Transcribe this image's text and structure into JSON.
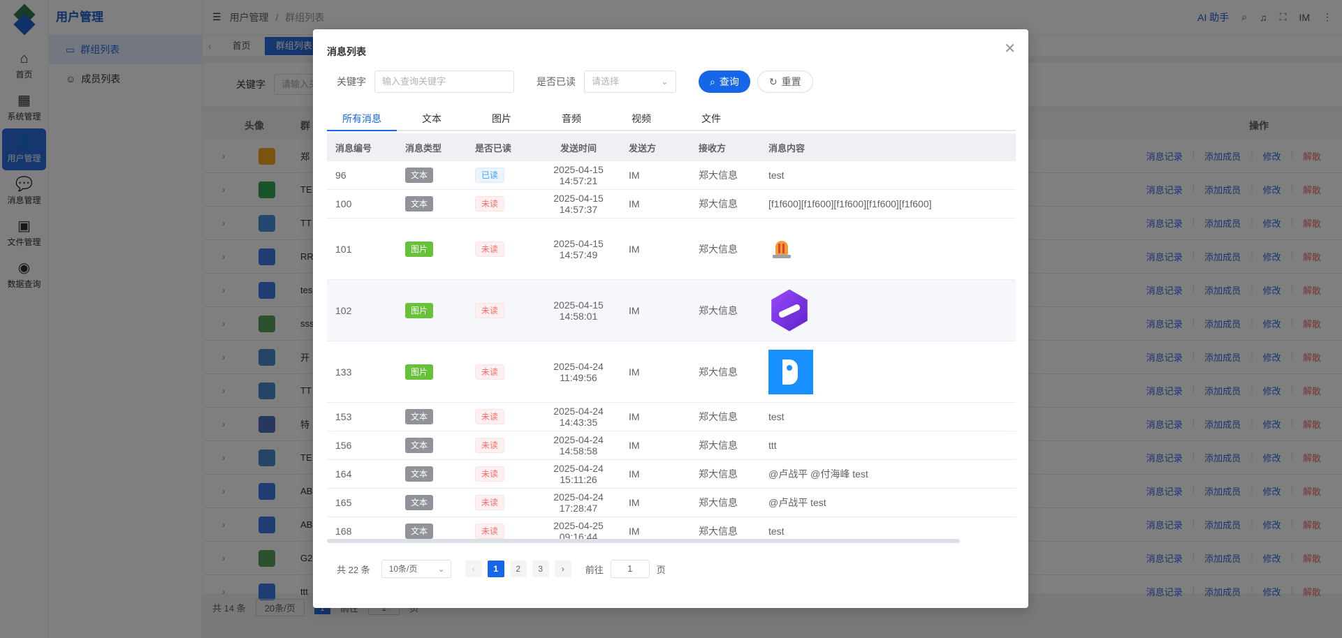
{
  "rail": [
    {
      "label": "首页",
      "icon": "home-icon",
      "glyph": "⌂"
    },
    {
      "label": "系统管理",
      "icon": "grid-icon",
      "glyph": "▦"
    },
    {
      "label": "用户管理",
      "icon": "user-icon",
      "glyph": "👤"
    },
    {
      "label": "消息管理",
      "icon": "chat-icon",
      "glyph": "💬"
    },
    {
      "label": "文件管理",
      "icon": "briefcase-icon",
      "glyph": "▣"
    },
    {
      "label": "数据查询",
      "icon": "compass-icon",
      "glyph": "◉"
    }
  ],
  "sidebar": {
    "title": "用户管理",
    "items": [
      {
        "label": "群组列表",
        "icon": "list-icon",
        "glyph": "▭"
      },
      {
        "label": "成员列表",
        "icon": "person-icon",
        "glyph": "☺"
      }
    ]
  },
  "topbar": {
    "menu_glyph": "☰",
    "crumb_1": "用户管理",
    "crumb_sep": "/",
    "crumb_2": "群组列表",
    "ai": "AI 助手",
    "user": "IM"
  },
  "tags": [
    "首页",
    "群组列表"
  ],
  "bg_search": {
    "label": "关键字",
    "placeholder": "请输入关"
  },
  "bg_table": {
    "col_avatar": "头像",
    "col_name": "群",
    "col_ops": "操作",
    "rows": [
      "郑",
      "TE",
      "TT",
      "RR",
      "tes",
      "sss",
      "开",
      "TT",
      "特",
      "TE",
      "AB",
      "AB",
      "G2",
      "ttt"
    ],
    "ops": [
      "消息记录",
      "添加成员",
      "修改",
      "解散"
    ]
  },
  "bg_footer": {
    "total": "共 14 条",
    "size": "20条/页",
    "page": "1",
    "goto": "前往",
    "goto_val": "1",
    "unit": "页"
  },
  "dialog": {
    "title": "消息列表",
    "close_glyph": "✕",
    "keyword_label": "关键字",
    "keyword_placeholder": "输入查询关键字",
    "read_label": "是否已读",
    "read_placeholder": "请选择",
    "search_btn": "查询",
    "reset_btn": "重置",
    "tabs": [
      "所有消息",
      "文本",
      "图片",
      "音频",
      "视频",
      "文件"
    ],
    "columns": [
      "消息编号",
      "消息类型",
      "是否已读",
      "发送时间",
      "发送方",
      "接收方",
      "消息内容"
    ],
    "rows": [
      {
        "id": "96",
        "type": "文本",
        "kind": "text",
        "read": "已读",
        "readkind": "read",
        "time": "2025-04-15 14:57:21",
        "from": "IM",
        "to": "郑大信息",
        "content": "test",
        "pic": ""
      },
      {
        "id": "100",
        "type": "文本",
        "kind": "text",
        "read": "未读",
        "readkind": "unread",
        "time": "2025-04-15 14:57:37",
        "from": "IM",
        "to": "郑大信息",
        "content": "[f1f600][f1f600][f1f600][f1f600][f1f600]",
        "pic": ""
      },
      {
        "id": "101",
        "type": "图片",
        "kind": "img",
        "read": "未读",
        "readkind": "unread",
        "time": "2025-04-15 14:57:49",
        "from": "IM",
        "to": "郑大信息",
        "content": "",
        "pic": "bell"
      },
      {
        "id": "102",
        "type": "图片",
        "kind": "img",
        "read": "未读",
        "readkind": "unread",
        "time": "2025-04-15 14:58:01",
        "from": "IM",
        "to": "郑大信息",
        "content": "",
        "pic": "hex"
      },
      {
        "id": "133",
        "type": "图片",
        "kind": "img",
        "read": "未读",
        "readkind": "unread",
        "time": "2025-04-24 11:49:56",
        "from": "IM",
        "to": "郑大信息",
        "content": "",
        "pic": "blue"
      },
      {
        "id": "153",
        "type": "文本",
        "kind": "text",
        "read": "未读",
        "readkind": "unread",
        "time": "2025-04-24 14:43:35",
        "from": "IM",
        "to": "郑大信息",
        "content": "test",
        "pic": ""
      },
      {
        "id": "156",
        "type": "文本",
        "kind": "text",
        "read": "未读",
        "readkind": "unread",
        "time": "2025-04-24 14:58:58",
        "from": "IM",
        "to": "郑大信息",
        "content": "ttt",
        "pic": ""
      },
      {
        "id": "164",
        "type": "文本",
        "kind": "text",
        "read": "未读",
        "readkind": "unread",
        "time": "2025-04-24 15:11:26",
        "from": "IM",
        "to": "郑大信息",
        "content": "@卢战平 @付海峰 test",
        "pic": ""
      },
      {
        "id": "165",
        "type": "文本",
        "kind": "text",
        "read": "未读",
        "readkind": "unread",
        "time": "2025-04-24 17:28:47",
        "from": "IM",
        "to": "郑大信息",
        "content": "@卢战平 test",
        "pic": ""
      },
      {
        "id": "168",
        "type": "文本",
        "kind": "text",
        "read": "未读",
        "readkind": "unread",
        "time": "2025-04-25 09:16:44",
        "from": "IM",
        "to": "郑大信息",
        "content": "test",
        "pic": ""
      }
    ],
    "pager": {
      "total": "共 22 条",
      "size": "10条/页",
      "pages": [
        "1",
        "2",
        "3"
      ],
      "current": "1",
      "goto": "前往",
      "goto_val": "1",
      "unit": "页"
    }
  },
  "colors": {
    "primary": "#1666e8",
    "danger": "#f56c6c",
    "success": "#67c23a"
  }
}
